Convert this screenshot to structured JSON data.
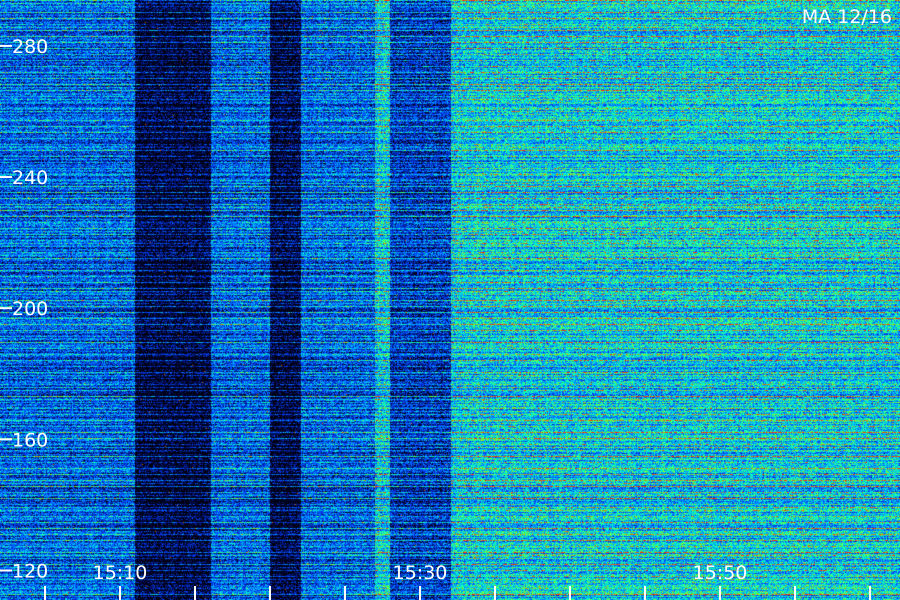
{
  "chart_data": {
    "type": "heatmap",
    "title": "",
    "station_label": "MA 12/16",
    "xlabel": "",
    "ylabel": "",
    "x_ticks": [
      "15:10",
      "15:30",
      "15:50"
    ],
    "x_tick_values_minutes": [
      910,
      930,
      950
    ],
    "x_range_minutes": [
      902,
      962
    ],
    "y_ticks": [
      "280",
      "240",
      "200",
      "160",
      "120"
    ],
    "y_tick_values": [
      280,
      240,
      200,
      160,
      120
    ],
    "y_range": [
      111,
      294
    ],
    "colormap": [
      "#000010",
      "#001a8c",
      "#0044ff",
      "#00a0ff",
      "#00ffc8",
      "#7dff2b",
      "#ff3300"
    ],
    "quiet_periods_minutes": [
      [
        911,
        916
      ],
      [
        920,
        922
      ],
      [
        928,
        932
      ]
    ],
    "active_period_minutes": [
      927,
      962
    ],
    "grid": false
  }
}
